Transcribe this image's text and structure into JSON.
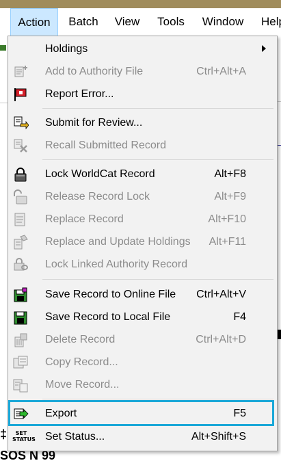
{
  "menubar": {
    "items": [
      "Action",
      "Batch",
      "View",
      "Tools",
      "Window",
      "Help"
    ],
    "active": "Action"
  },
  "background": {
    "bottom_text": "SOS N 99"
  },
  "menu": {
    "items": [
      {
        "label": "Holdings",
        "shortcut": "",
        "enabled": true,
        "submenu": true,
        "icon": "none"
      },
      {
        "label": "Add to Authority File",
        "shortcut": "Ctrl+Alt+A",
        "enabled": false,
        "icon": "add-authority-icon"
      },
      {
        "label": "Report Error...",
        "shortcut": "",
        "enabled": true,
        "icon": "report-error-flag-icon"
      },
      {
        "label": "Submit for Review...",
        "shortcut": "",
        "enabled": true,
        "icon": "submit-review-icon"
      },
      {
        "label": "Recall Submitted Record",
        "shortcut": "",
        "enabled": false,
        "icon": "recall-record-icon"
      },
      {
        "label": "Lock WorldCat Record",
        "shortcut": "Alt+F8",
        "enabled": true,
        "icon": "lock-icon"
      },
      {
        "label": "Release Record Lock",
        "shortcut": "Alt+F9",
        "enabled": false,
        "icon": "unlock-icon"
      },
      {
        "label": "Replace Record",
        "shortcut": "Alt+F10",
        "enabled": false,
        "icon": "replace-record-icon"
      },
      {
        "label": "Replace and Update Holdings",
        "shortcut": "Alt+F11",
        "enabled": false,
        "icon": "replace-holdings-icon"
      },
      {
        "label": "Lock Linked Authority Record",
        "shortcut": "",
        "enabled": false,
        "icon": "lock-linked-icon"
      },
      {
        "label": "Save Record to Online File",
        "shortcut": "Ctrl+Alt+V",
        "enabled": true,
        "icon": "save-online-icon"
      },
      {
        "label": "Save Record to Local File",
        "shortcut": "F4",
        "enabled": true,
        "icon": "save-local-icon"
      },
      {
        "label": "Delete Record",
        "shortcut": "Ctrl+Alt+D",
        "enabled": false,
        "icon": "delete-record-icon"
      },
      {
        "label": "Copy Record...",
        "shortcut": "",
        "enabled": false,
        "icon": "copy-record-icon"
      },
      {
        "label": "Move Record...",
        "shortcut": "",
        "enabled": false,
        "icon": "move-record-icon"
      },
      {
        "label": "Export",
        "shortcut": "F5",
        "enabled": true,
        "highlighted": true,
        "icon": "export-icon"
      },
      {
        "label": "Set Status...",
        "shortcut": "Alt+Shift+S",
        "enabled": true,
        "icon": "set-status-icon"
      }
    ],
    "set_status_icon_text": [
      "SET",
      "STATUS"
    ]
  },
  "colors": {
    "highlight_border": "#1ba8d8",
    "active_tab": "#cce8ff",
    "disabled_text": "#8c8c8c",
    "menu_bg": "#f2f2f2"
  }
}
